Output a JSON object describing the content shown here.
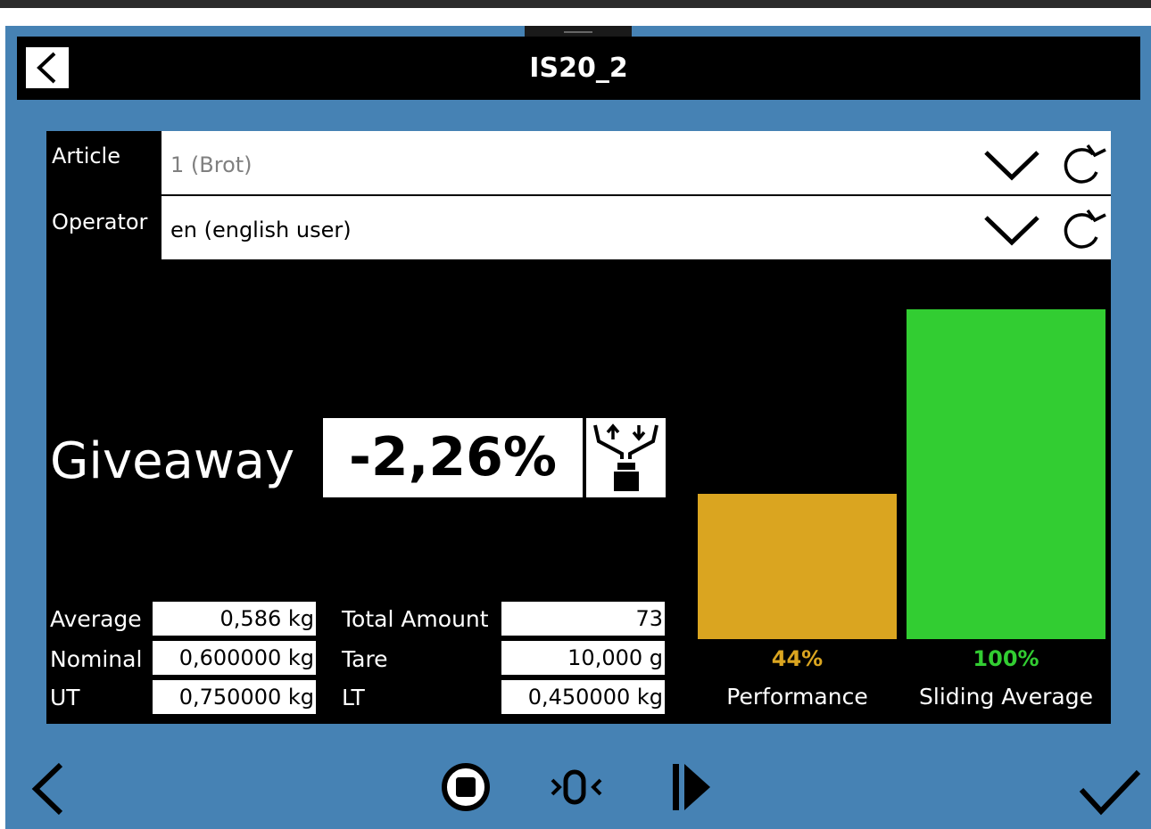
{
  "window": {
    "title": "IS20_2"
  },
  "form": {
    "article_label": "Article",
    "article_value": "1 (Brot)",
    "operator_label": "Operator",
    "operator_value": "en (english user)"
  },
  "giveaway": {
    "label": "Giveaway",
    "value": "-2,26%"
  },
  "stats": {
    "average_label": "Average",
    "average_value": "0,586 kg",
    "nominal_label": "Nominal",
    "nominal_value": "0,600000 kg",
    "ut_label": "UT",
    "ut_value": "0,750000 kg",
    "total_label": "Total Amount",
    "total_value": "73",
    "tare_label": "Tare",
    "tare_value": "10,000 g",
    "lt_label": "LT",
    "lt_value": "0,450000 kg"
  },
  "bars": {
    "performance": {
      "label": "Performance",
      "percent_text": "44%",
      "level": 0.44,
      "color": "#daa520"
    },
    "sliding": {
      "label": "Sliding Average",
      "percent_text": "100%",
      "level": 1.0,
      "color": "#32cd32"
    }
  },
  "icons": {
    "back": "back-chevron-icon",
    "dropdown": "chevron-down-icon",
    "refresh": "refresh-icon",
    "scale": "scale-weight-icon",
    "prev": "previous-icon",
    "stop": "stop-icon",
    "zero": "zero-icon",
    "step": "step-forward-icon",
    "confirm": "checkmark-icon"
  }
}
